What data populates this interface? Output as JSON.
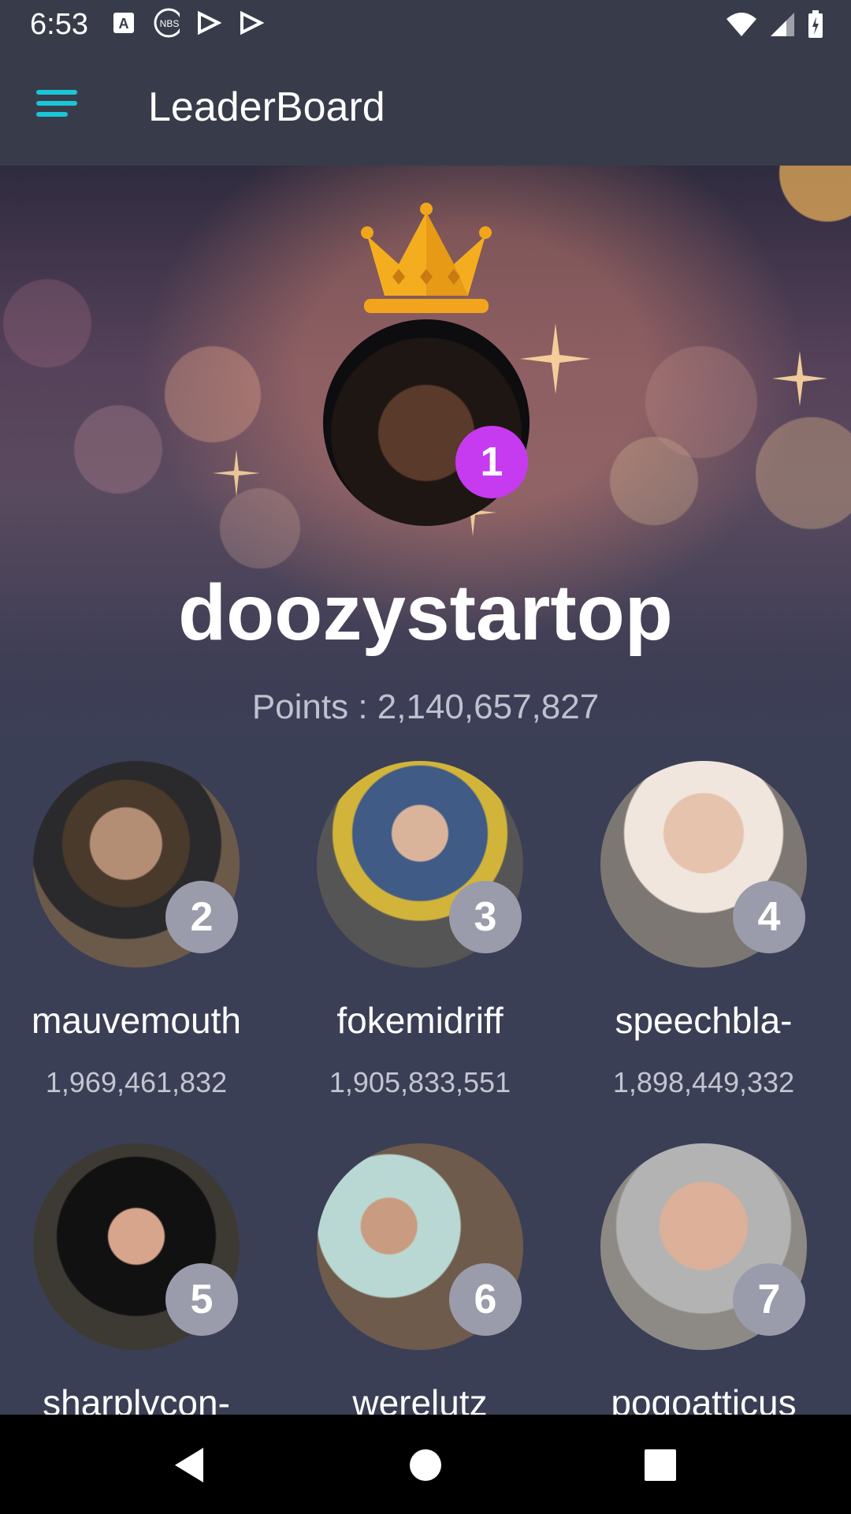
{
  "status_bar": {
    "time": "6:53",
    "icons": [
      "translate-icon",
      "nbs-icon",
      "play-store-icon",
      "play-store-icon"
    ],
    "right_icons": [
      "wifi-icon",
      "signal-icon",
      "battery-icon"
    ]
  },
  "app_bar": {
    "title": "LeaderBoard",
    "menu_icon": "hamburger-menu-icon",
    "accent": "#19c6d8"
  },
  "winner": {
    "name": "doozystartop",
    "points": "Points : 2,140,657,827",
    "rank": "1",
    "badge_color": "#c63bf0"
  },
  "players": [
    {
      "rank": "2",
      "name": "mauvemouth",
      "points": "1,969,461,832"
    },
    {
      "rank": "3",
      "name": "fokemidriff",
      "points": "1,905,833,551"
    },
    {
      "rank": "4",
      "name": "speechbla-",
      "points": "1,898,449,332"
    },
    {
      "rank": "5",
      "name": "sharplycon-",
      "points": ""
    },
    {
      "rank": "6",
      "name": "werelutz",
      "points": ""
    },
    {
      "rank": "7",
      "name": "pogoatticus",
      "points": ""
    }
  ],
  "nav_bar": {
    "buttons": [
      "back-icon",
      "home-icon",
      "recents-icon"
    ]
  }
}
